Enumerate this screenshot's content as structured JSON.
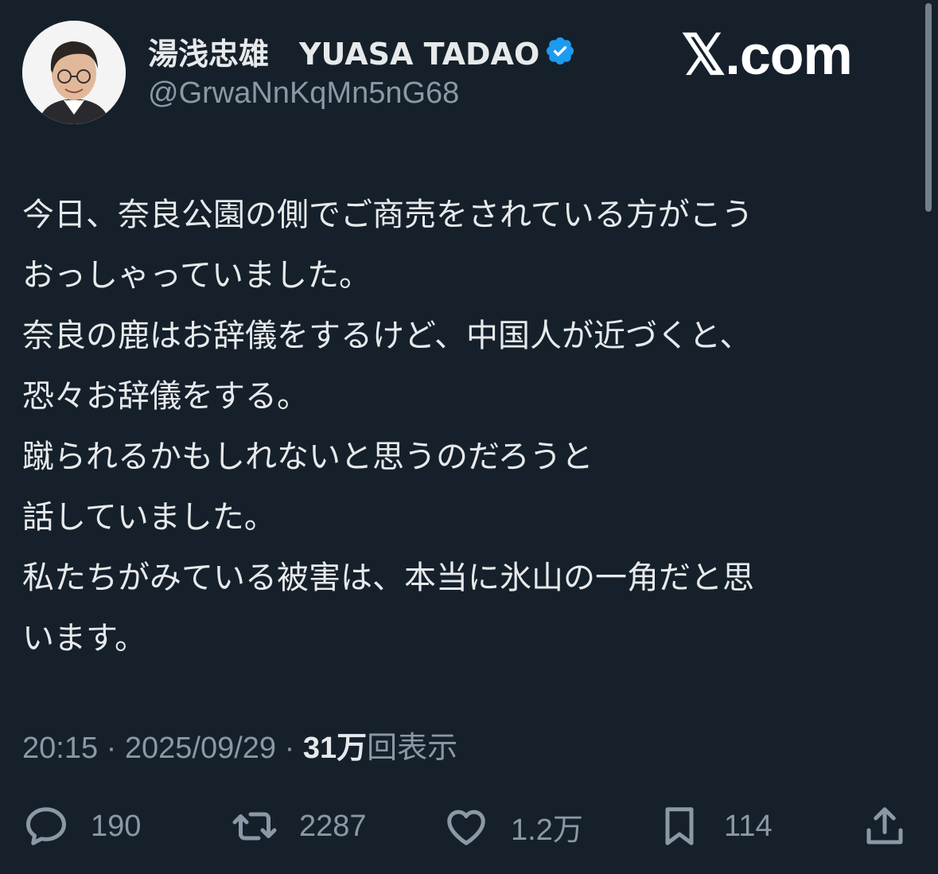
{
  "user": {
    "display_name": "湯浅忠雄　YUASA TADAO",
    "handle": "@GrwaNnKqMn5nG68",
    "verified_color": "#1d9bf0"
  },
  "brand": {
    "logo_text": "𝕏.com"
  },
  "tweet": {
    "lines": [
      "今日、奈良公園の側でご商売をされている方がこう",
      "おっしゃっていました。",
      "奈良の鹿はお辞儀をするけど、中国人が近づくと、",
      "恐々お辞儀をする。",
      "蹴られるかもしれないと思うのだろうと",
      "話していました。",
      "私たちがみている被害は、本当に氷山の一角だと思",
      "います。"
    ],
    "time": "20:15",
    "date": "2025/09/29",
    "separator": " · ",
    "views_count": "31万",
    "views_label": "回表示"
  },
  "actions": {
    "replies": "190",
    "reposts": "2287",
    "likes": "1.2万",
    "bookmarks": "114"
  },
  "icons": {
    "reply": "reply-icon",
    "repost": "repost-icon",
    "like": "heart-icon",
    "bookmark": "bookmark-icon",
    "share": "share-icon",
    "verified": "verified-badge-icon"
  },
  "colors": {
    "background": "#15202b",
    "text": "#e7e9ea",
    "muted": "#8b98a5"
  }
}
